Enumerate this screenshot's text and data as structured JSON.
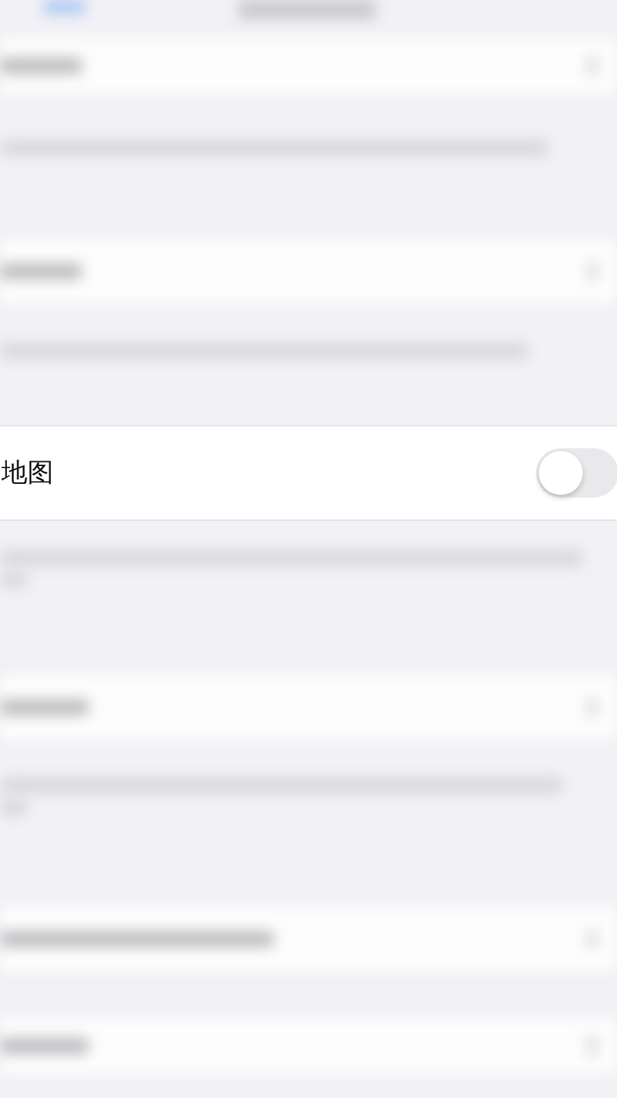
{
  "settings_row": {
    "label": "地图",
    "on": false
  }
}
